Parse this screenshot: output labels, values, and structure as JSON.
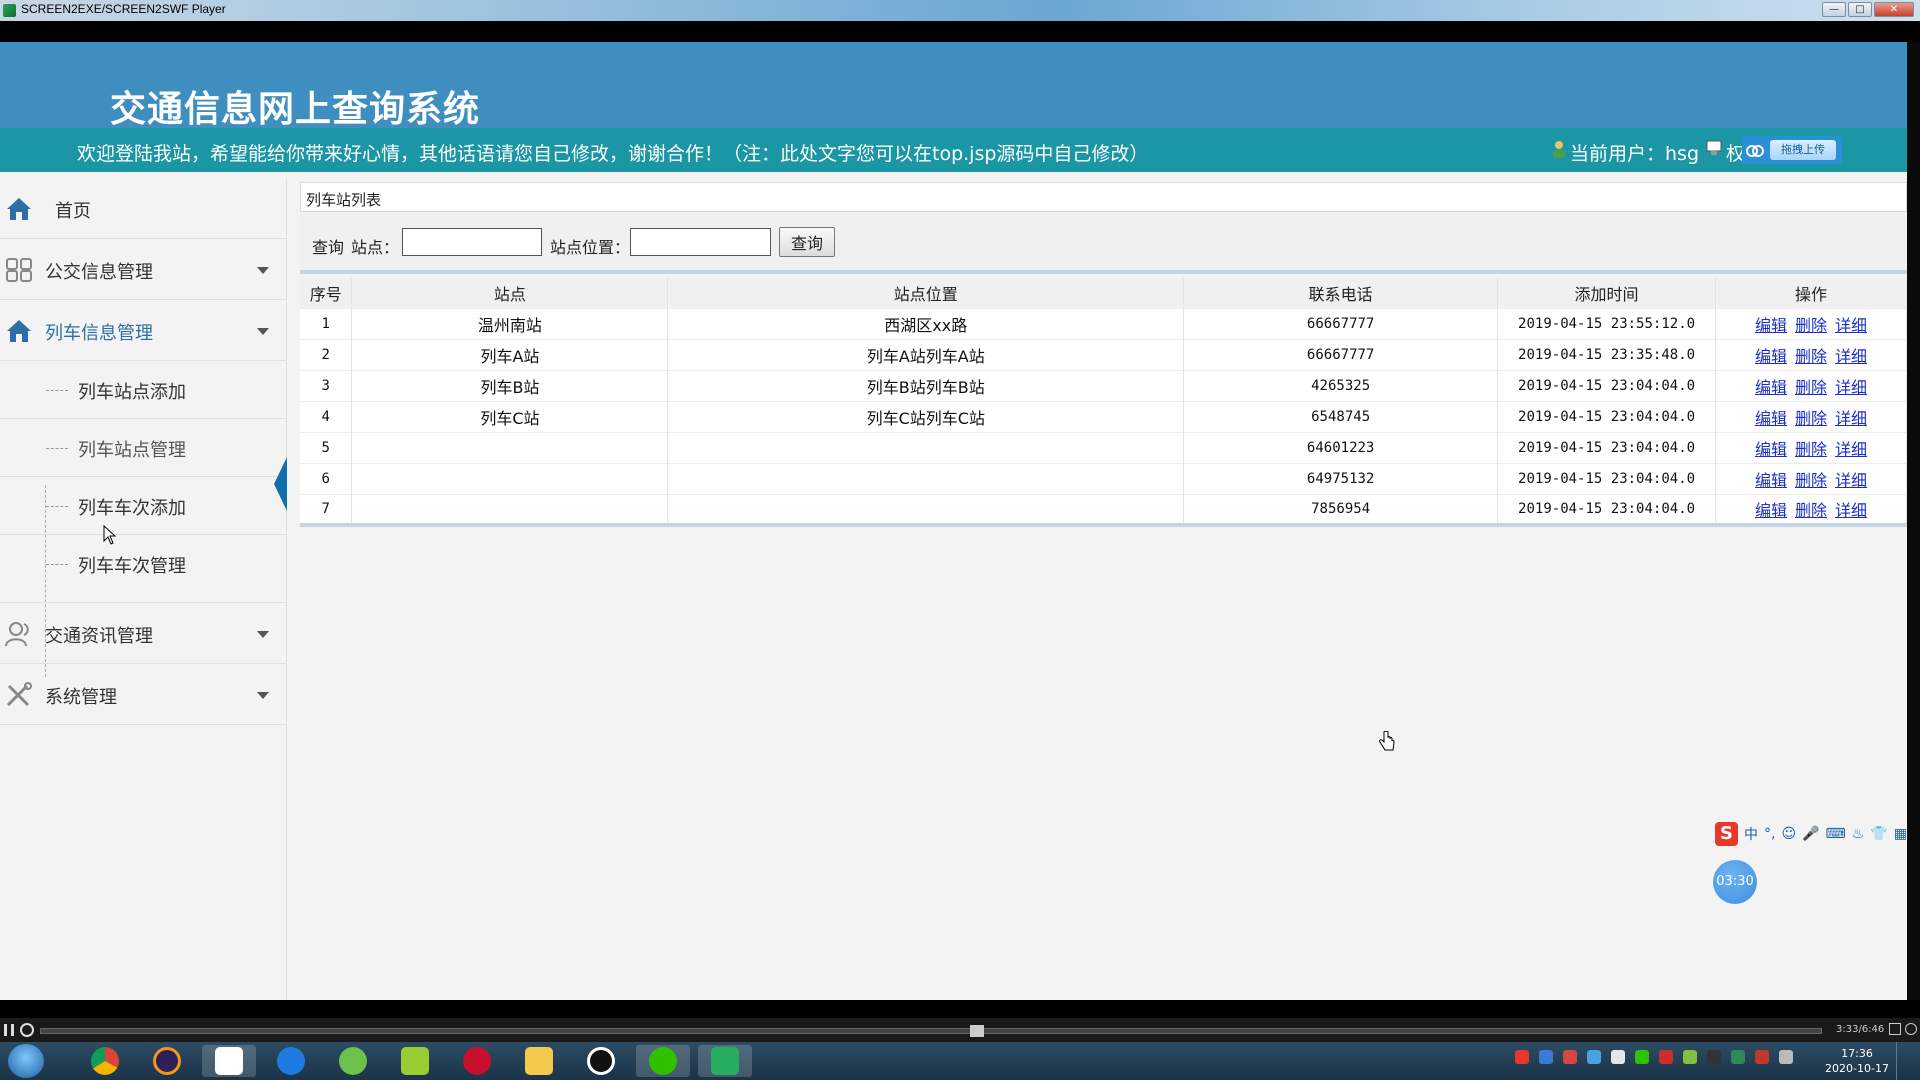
{
  "window": {
    "title": "SCREEN2EXE/SCREEN2SWF Player",
    "buttons": [
      "—",
      "□",
      "✕"
    ]
  },
  "header": {
    "site_title": "交通信息网上查询系统"
  },
  "infobar": {
    "welcome": "欢迎登陆我站，希望能给你带来好心情，其他话语请您自己修改，谢谢合作！（注：此处文字您可以在top.jsp源码中自己修改）",
    "current_user": "当前用户：hsg",
    "role": "权      理员  退出",
    "upload_label": "拖拽上传"
  },
  "sidebar": {
    "items": [
      {
        "label": "首页",
        "icon": "home-icon"
      },
      {
        "label": "公交信息管理",
        "icon": "grid-icon"
      },
      {
        "label": "列车信息管理",
        "icon": "home-icon"
      },
      {
        "label": "交通资讯管理",
        "icon": "user-icon"
      },
      {
        "label": "系统管理",
        "icon": "tools-icon"
      }
    ],
    "sub_items": [
      {
        "label": "列车站点添加"
      },
      {
        "label": "列车站点管理"
      },
      {
        "label": "列车车次添加"
      },
      {
        "label": "列车车次管理"
      }
    ]
  },
  "content": {
    "panel_title": "列车站列表",
    "search": {
      "query_label": "查询",
      "station_label": "站点：",
      "station_value": "",
      "location_label": "站点位置：",
      "location_value": "",
      "button_label": "查询"
    },
    "table": {
      "headers": [
        "序号",
        "站点",
        "站点位置",
        "联系电话",
        "添加时间",
        "操作"
      ],
      "rows": [
        {
          "no": "1",
          "station": "温州南站",
          "location": "西湖区xx路",
          "phone": "66667777",
          "time": "2019-04-15 23:55:12.0"
        },
        {
          "no": "2",
          "station": "列车A站",
          "location": "列车A站列车A站",
          "phone": "66667777",
          "time": "2019-04-15 23:35:48.0"
        },
        {
          "no": "3",
          "station": "列车B站",
          "location": "列车B站列车B站",
          "phone": "4265325",
          "time": "2019-04-15 23:04:04.0"
        },
        {
          "no": "4",
          "station": "列车C站",
          "location": "列车C站列车C站",
          "phone": "6548745",
          "time": "2019-04-15 23:04:04.0"
        },
        {
          "no": "5",
          "station": "",
          "location": "",
          "phone": "64601223",
          "time": "2019-04-15 23:04:04.0"
        },
        {
          "no": "6",
          "station": "",
          "location": "",
          "phone": "64975132",
          "time": "2019-04-15 23:04:04.0"
        },
        {
          "no": "7",
          "station": "",
          "location": "",
          "phone": "7856954",
          "time": "2019-04-15 23:04:04.0"
        }
      ],
      "actions": [
        "编辑",
        "删除",
        "详细"
      ]
    }
  },
  "ime": {
    "logo": "S",
    "items": [
      "中",
      "°,",
      "☺",
      "🎤",
      "⌨",
      "♨",
      "👕",
      "▦"
    ]
  },
  "timer_bubble": "03:30",
  "player": {
    "time": "3:33/6:46"
  },
  "taskbar": {
    "time": "17:36",
    "date": "2020-10-17"
  },
  "colors": {
    "header_bg": "#3e8fc0",
    "infobar_bg": "#1b96a4",
    "link": "#1c2fc9",
    "active_marker": "#0f6fa8"
  }
}
